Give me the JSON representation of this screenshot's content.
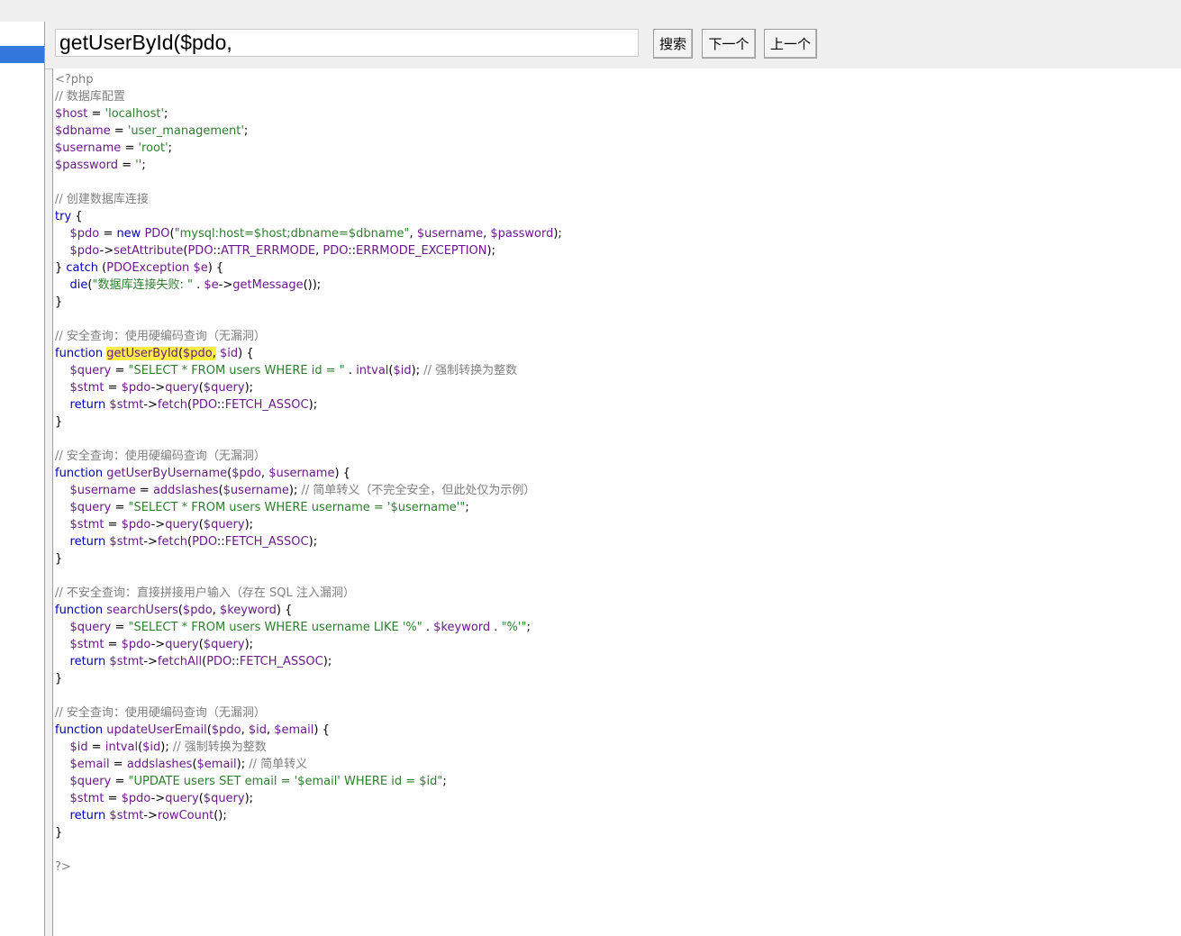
{
  "search": {
    "value": "getUserById($pdo,",
    "search_label": "搜索",
    "next_label": "下一个",
    "prev_label": "上一个"
  },
  "code_lines": [
    "<?php",
    "// 数据库配置",
    "$host = 'localhost';",
    "$dbname = 'user_management';",
    "$username = 'root';",
    "$password = '';",
    "",
    "// 创建数据库连接",
    "try {",
    "    $pdo = new PDO(\"mysql:host=$host;dbname=$dbname\", $username, $password);",
    "    $pdo->setAttribute(PDO::ATTR_ERRMODE, PDO::ERRMODE_EXCEPTION);",
    "} catch (PDOException $e) {",
    "    die(\"数据库连接失败: \" . $e->getMessage());",
    "}",
    "",
    "// 安全查询：使用硬编码查询（无漏洞）",
    "function getUserById($pdo, $id) {",
    "    $query = \"SELECT * FROM users WHERE id = \" . intval($id); // 强制转换为整数",
    "    $stmt = $pdo->query($query);",
    "    return $stmt->fetch(PDO::FETCH_ASSOC);",
    "}",
    "",
    "// 安全查询：使用硬编码查询（无漏洞）",
    "function getUserByUsername($pdo, $username) {",
    "    $username = addslashes($username); // 简单转义（不完全安全，但此处仅为示例）",
    "    $query = \"SELECT * FROM users WHERE username = '$username'\";",
    "    $stmt = $pdo->query($query);",
    "    return $stmt->fetch(PDO::FETCH_ASSOC);",
    "}",
    "",
    "// 不安全查询：直接拼接用户输入（存在 SQL 注入漏洞）",
    "function searchUsers($pdo, $keyword) {",
    "    $query = \"SELECT * FROM users WHERE username LIKE '%\" . $keyword . \"%'\";",
    "    $stmt = $pdo->query($query);",
    "    return $stmt->fetchAll(PDO::FETCH_ASSOC);",
    "}",
    "",
    "// 安全查询：使用硬编码查询（无漏洞）",
    "function updateUserEmail($pdo, $id, $email) {",
    "    $id = intval($id); // 强制转换为整数",
    "    $email = addslashes($email); // 简单转义",
    "    $query = \"UPDATE users SET email = '$email' WHERE id = $id\";",
    "    $stmt = $pdo->query($query);",
    "    return $stmt->rowCount();",
    "}",
    "",
    "?>"
  ]
}
